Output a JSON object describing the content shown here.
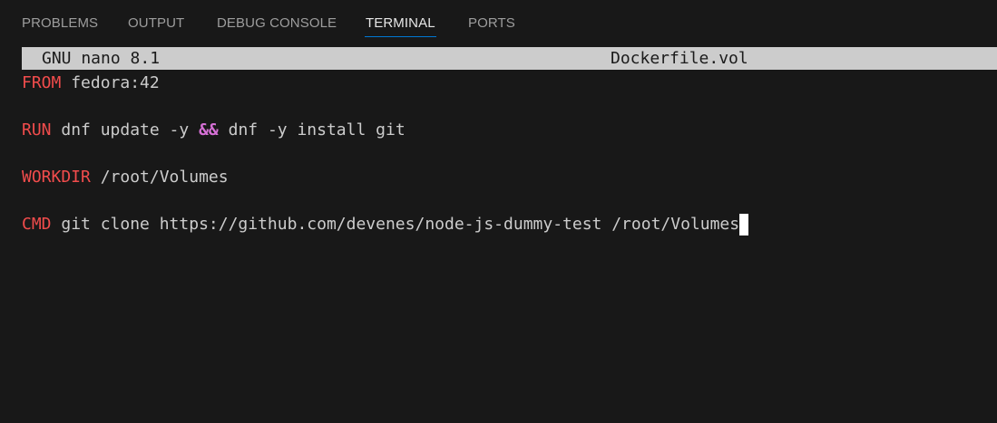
{
  "tabs": [
    {
      "label": "PROBLEMS",
      "active": false
    },
    {
      "label": "OUTPUT",
      "active": false
    },
    {
      "label": "DEBUG CONSOLE",
      "active": false
    },
    {
      "label": "TERMINAL",
      "active": true
    },
    {
      "label": "PORTS",
      "active": false
    }
  ],
  "nano": {
    "version": "GNU nano 8.1",
    "filename": "Dockerfile.vol"
  },
  "file_lines": [
    {
      "keyword": "FROM",
      "text": " fedora:42"
    },
    {
      "keyword": "RUN",
      "text_before": " dnf update -y ",
      "operator": "&&",
      "text_after": " dnf -y install git"
    },
    {
      "keyword": "WORKDIR",
      "text": " /root/Volumes"
    },
    {
      "keyword": "CMD",
      "text": " git clone https://github.com/devenes/node-js-dummy-test /root/Volumes"
    }
  ],
  "colors": {
    "background": "#181818",
    "header_bg": "#cccccc",
    "keyword": "#f14c4c",
    "operator": "#d670d6",
    "text": "#cccccc",
    "tab_active_underline": "#0078d4"
  }
}
